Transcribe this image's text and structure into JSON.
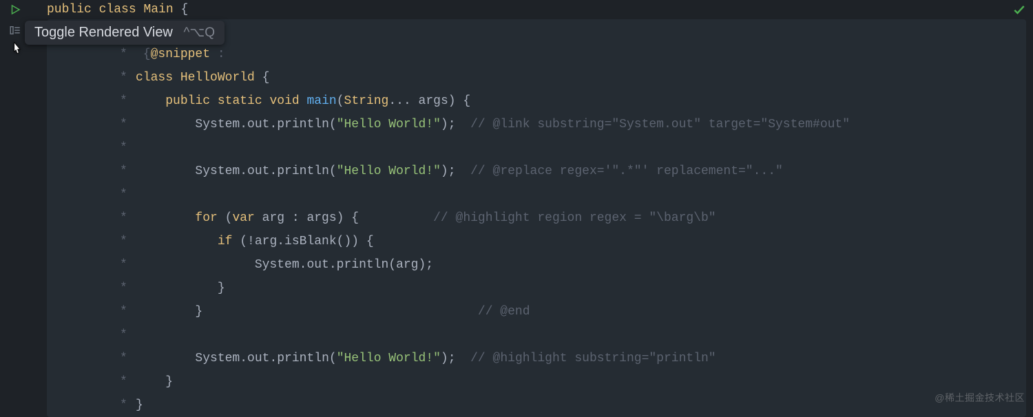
{
  "tooltip": {
    "label": "Toggle Rendered View",
    "shortcut": "^⌥Q"
  },
  "gutter": {
    "run_icon": "play-icon",
    "toggle_icon": "toggle-rendered-icon"
  },
  "status": {
    "ok_icon": "check-icon"
  },
  "watermark": "@稀土掘金技术社区",
  "code": {
    "l0_public": "public",
    "l0_class": "class",
    "l0_main": "Main",
    "l0_brace": " {",
    "star": "*",
    "l2_snippet_open": " {",
    "l2_snippet_tag": "@snippet",
    "l2_snippet_colon": " :",
    "l3_class": "class",
    "l3_name": "HelloWorld",
    "l3_brace": " {",
    "l4_public": "public",
    "l4_static": "static",
    "l4_void": "void",
    "l4_main": "main",
    "l4_lp": "(",
    "l4_string": "String",
    "l4_dots": "...",
    "l4_args": " args",
    "l4_rp": ")",
    "l4_brace": " {",
    "l5_sys": "System",
    "l5_out": ".out",
    "l5_println": ".println",
    "l5_lp": "(",
    "l5_str": "\"Hello World!\"",
    "l5_rp_semi": ");",
    "l5_cmt": "  // @link substring=\"System.out\" target=\"System#out\"",
    "l7_sys": "System",
    "l7_out": ".out",
    "l7_println": ".println",
    "l7_lp": "(",
    "l7_str": "\"Hello World!\"",
    "l7_rp_semi": ");",
    "l7_cmt": "  // @replace regex='\".*\"' replacement=\"...\"",
    "l9_for": "for",
    "l9_lp": " (",
    "l9_var": "var",
    "l9_arg": " arg : args",
    "l9_rp": ")",
    "l9_brace": " {",
    "l9_cmt": "          // @highlight region regex = \"\\barg\\b\"",
    "l10_if": "if",
    "l10_cond": " (!arg.isBlank()) {",
    "l11_sys": "System",
    "l11_out": ".out",
    "l11_println": ".println",
    "l11_arg": "(arg);",
    "l12_rb": "}",
    "l13_rb": "}",
    "l13_cmt": "                                     // @end",
    "l15_sys": "System",
    "l15_out": ".out",
    "l15_println": ".println",
    "l15_lp": "(",
    "l15_str": "\"Hello World!\"",
    "l15_rp_semi": ");",
    "l15_cmt": "  // @highlight substring=\"println\"",
    "l16_rb": "}",
    "l17_rb": "}"
  }
}
